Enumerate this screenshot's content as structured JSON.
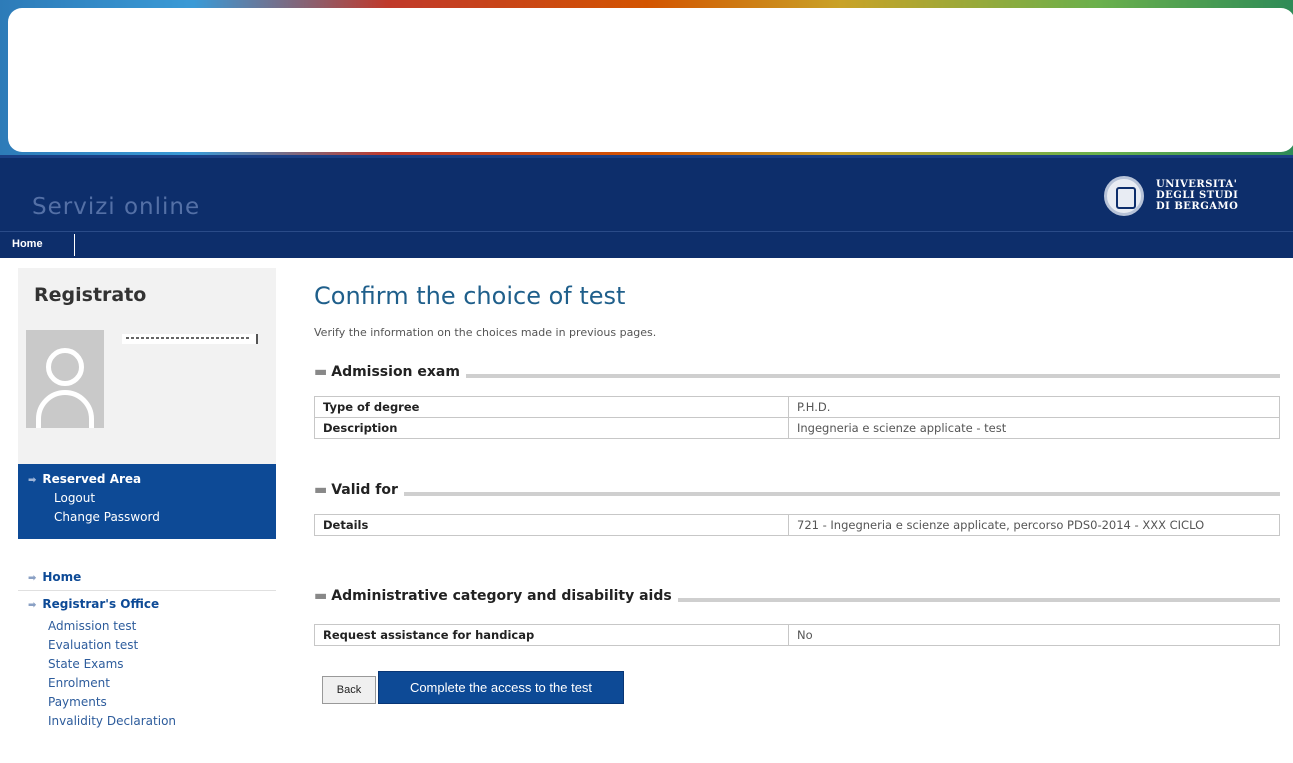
{
  "header": {
    "site_title": "Servizi online",
    "university": [
      "UNIVERSITA'",
      "DEGLI STUDI",
      "DI BERGAMO"
    ]
  },
  "nav": {
    "home": "Home"
  },
  "sidebar": {
    "title": "Registrato",
    "reserved_area": {
      "title": "Reserved Area",
      "links": [
        "Logout",
        "Change Password"
      ]
    },
    "menu": {
      "home": "Home",
      "registrar": "Registrar's Office",
      "items": [
        "Admission test",
        "Evaluation test",
        "State Exams",
        "Enrolment",
        "Payments",
        "Invalidity Declaration"
      ]
    }
  },
  "main": {
    "title": "Confirm the choice of test",
    "intro": "Verify the information on the choices made in previous pages.",
    "sections": [
      {
        "legend": "Admission exam",
        "rows": [
          {
            "key": "Type of degree",
            "value": "P.H.D."
          },
          {
            "key": "Description",
            "value": "Ingegneria e scienze applicate - test"
          }
        ]
      },
      {
        "legend": "Valid for",
        "rows": [
          {
            "key": "Details",
            "value": "721 - Ingegneria e scienze applicate, percorso PDS0-2014 - XXX CICLO"
          }
        ]
      },
      {
        "legend": "Administrative category and disability aids",
        "rows": [
          {
            "key": "Request assistance for handicap",
            "value": "No"
          }
        ]
      }
    ],
    "buttons": {
      "back": "Back",
      "complete": "Complete the access to the test"
    }
  },
  "colors": {
    "header_bg": "#0d2e6b",
    "accent": "#0d4a96",
    "title": "#1f5f8b"
  }
}
